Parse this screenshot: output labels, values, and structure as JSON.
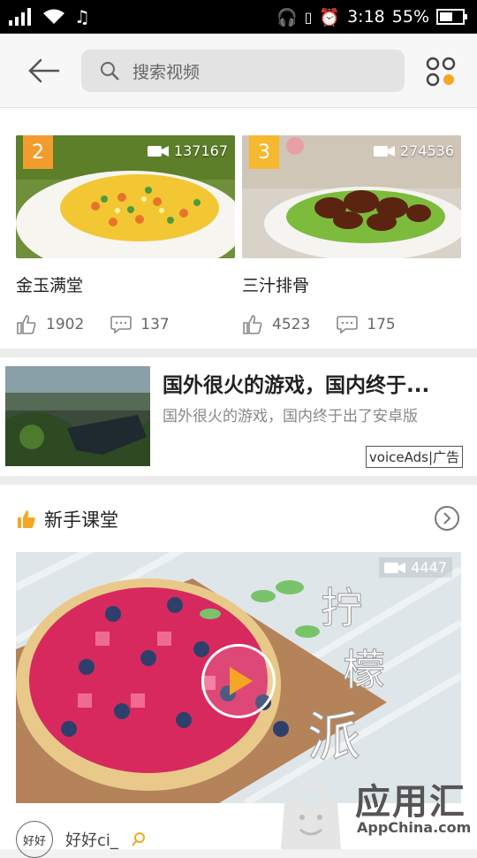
{
  "status": {
    "time": "3:18",
    "battery": "55%"
  },
  "search": {
    "placeholder": "搜索视频"
  },
  "top_cards": [
    {
      "rank": "2",
      "views": "137167",
      "title": "金玉满堂",
      "likes": "1902",
      "comments": "137"
    },
    {
      "rank": "3",
      "views": "274536",
      "title": "三汁排骨",
      "likes": "4523",
      "comments": "175"
    }
  ],
  "ad": {
    "title": "国外很火的游戏，国内终于...",
    "desc": "国外很火的游戏，国内终于出了安卓版",
    "badge": "voiceAds|广告"
  },
  "section": {
    "title": "新手课堂",
    "views": "4447",
    "author": "好好ci_",
    "avatar_text": "好好"
  },
  "watermark": {
    "text": "应用汇",
    "url": "AppChina.com"
  },
  "colors": {
    "accent": "#f5a623",
    "rank2": "#f39c2e",
    "rank3": "#f5b82e"
  }
}
